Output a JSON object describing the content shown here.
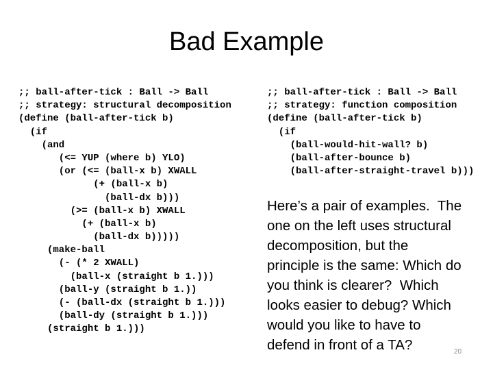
{
  "slide": {
    "title": "Bad Example",
    "left_code": [
      ";; ball-after-tick : Ball -> Ball",
      ";; strategy: structural decomposition",
      "(define (ball-after-tick b)",
      "  (if",
      "    (and",
      "       (<= YUP (where b) YLO)",
      "       (or (<= (ball-x b) XWALL",
      "             (+ (ball-x b)",
      "               (ball-dx b)))",
      "         (>= (ball-x b) XWALL",
      "           (+ (ball-x b)",
      "             (ball-dx b)))))",
      "     (make-ball",
      "       (- (* 2 XWALL)",
      "         (ball-x (straight b 1.)))",
      "       (ball-y (straight b 1.))",
      "       (- (ball-dx (straight b 1.)))",
      "       (ball-dy (straight b 1.)))",
      "     (straight b 1.)))"
    ],
    "right_code": [
      ";; ball-after-tick : Ball -> Ball",
      ";; strategy: function composition",
      "(define (ball-after-tick b)",
      "  (if",
      "    (ball-would-hit-wall? b)",
      "    (ball-after-bounce b)",
      "    (ball-after-straight-travel b)))"
    ],
    "explanation_lines": [
      "Here’s a pair of examples.  The",
      "one on the left uses structural",
      "decomposition, but the",
      "principle is the same: Which do",
      "you think is clearer?  Which",
      "looks easier to debug? Which",
      "would you like to have to",
      "defend in front of a TA?"
    ],
    "page_number": "20"
  }
}
